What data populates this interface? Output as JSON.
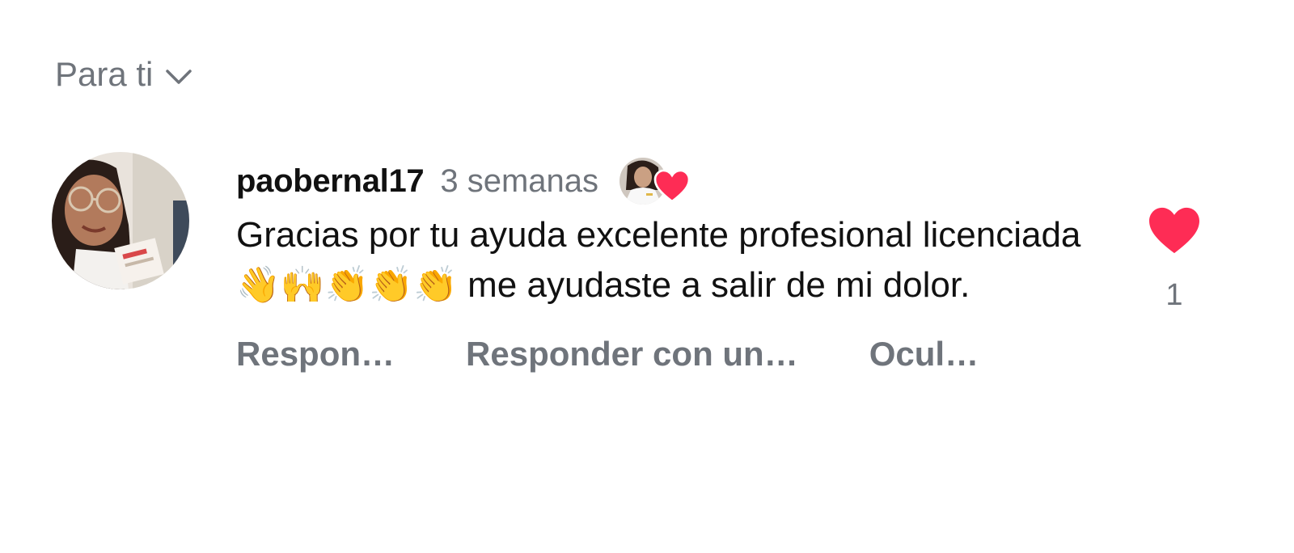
{
  "sort": {
    "label": "Para ti",
    "icon": "chevron-down-icon"
  },
  "comment": {
    "username": "paobernal17",
    "timestamp": "3 semanas",
    "creator_liked": true,
    "text": "Gracias por tu ayuda excelente profesional licenciada 👋🙌👏👏👏 me ayudaste a salir de mi dolor.",
    "actions": {
      "reply": "Respon…",
      "reply_video": "Responder con un…",
      "hide": "Ocul…"
    },
    "like": {
      "count": "1",
      "liked": true,
      "color": "#fe2c55"
    }
  },
  "colors": {
    "secondary_text": "#6f747b",
    "primary_text": "#111111",
    "heart": "#fe2c55"
  }
}
